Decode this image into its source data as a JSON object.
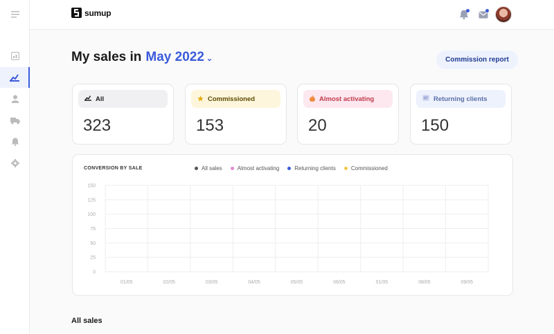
{
  "brand": {
    "name": "sumup"
  },
  "header": {
    "title_prefix": "My sales in",
    "month": "May 2022",
    "commission_report": "Commission report"
  },
  "sidebar": {
    "items": [
      {
        "icon": "menu-icon"
      },
      {
        "icon": "dashboard-icon"
      },
      {
        "icon": "sales-icon",
        "active": true
      },
      {
        "icon": "user-icon"
      },
      {
        "icon": "truck-icon"
      },
      {
        "icon": "bell-icon"
      },
      {
        "icon": "gear-icon"
      }
    ]
  },
  "cards": [
    {
      "label": "All",
      "value": "323",
      "icon": "sales-icon",
      "bg": "#f0f0f2",
      "color": "#1a1a1a"
    },
    {
      "label": "Commissioned",
      "value": "153",
      "icon": "star-icon",
      "bg": "#fdf6dc",
      "color": "#5c4a00"
    },
    {
      "label": "Almost activating",
      "value": "20",
      "icon": "fire-icon",
      "bg": "#fde8ef",
      "color": "#c0394b"
    },
    {
      "label": "Returning clients",
      "value": "150",
      "icon": "returning-icon",
      "bg": "#eef2fc",
      "color": "#5a6fa8"
    }
  ],
  "chart": {
    "title": "CONVERSION BY SALE",
    "legend": [
      {
        "name": "All sales",
        "color": "#555555"
      },
      {
        "name": "Almost activating",
        "color": "#e58bd0"
      },
      {
        "name": "Returning clients",
        "color": "#3b5bdb"
      },
      {
        "name": "Commissioned",
        "color": "#f2c94c"
      }
    ]
  },
  "chart_data": {
    "type": "line",
    "title": "CONVERSION BY SALE",
    "x": [
      "01/05",
      "02/05",
      "03/05",
      "04/05",
      "05/05",
      "06/05",
      "01/05",
      "08/05",
      "09/05"
    ],
    "yticks": [
      0,
      25,
      50,
      75,
      100,
      125,
      150
    ],
    "ylim": [
      0,
      150
    ],
    "series": [
      {
        "name": "All sales",
        "values": []
      },
      {
        "name": "Almost activating",
        "values": []
      },
      {
        "name": "Returning clients",
        "values": []
      },
      {
        "name": "Commissioned",
        "values": []
      }
    ],
    "grid": true,
    "legend_position": "top"
  },
  "section": {
    "all_sales": "All sales"
  }
}
